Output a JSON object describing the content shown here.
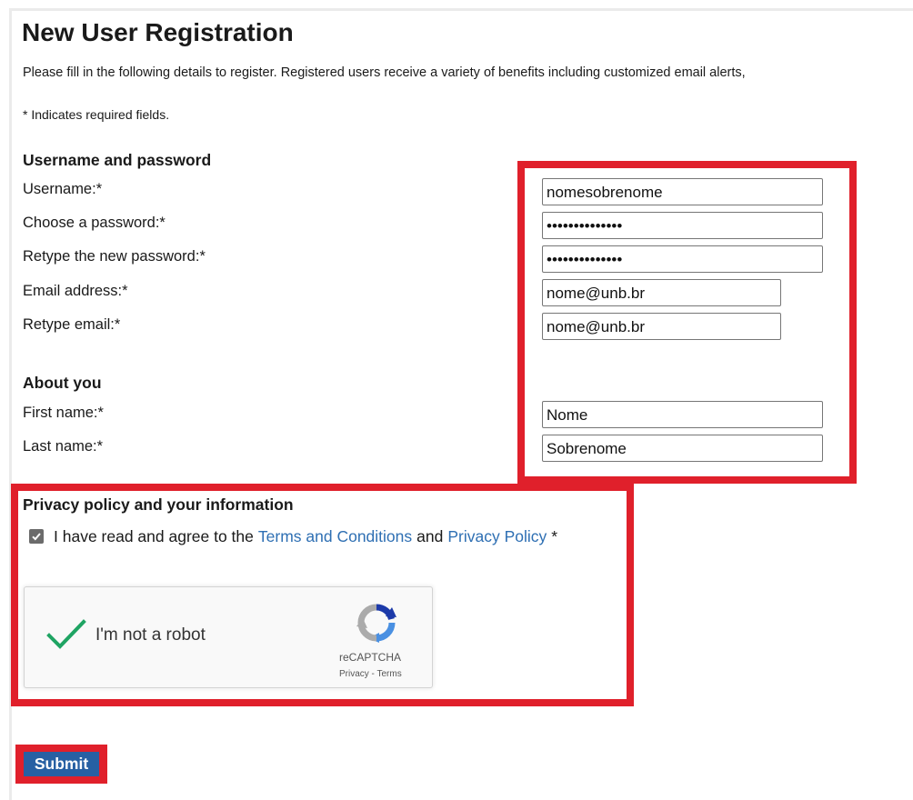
{
  "page": {
    "title": "New User Registration",
    "intro": "Please fill in the following details to register. Registered users receive a variety of benefits including customized email alerts,",
    "required_note": "* Indicates required fields."
  },
  "credentials": {
    "section_title": "Username and password",
    "username_label": "Username:*",
    "username_value": "nomesobrenome",
    "password_label": "Choose a password:*",
    "password_value": "nomesobrenome1",
    "retype_password_label": "Retype the new password:*",
    "retype_password_value": "nomesobrenome1",
    "email_label": "Email address:*",
    "email_value": "nome@unb.br",
    "retype_email_label": "Retype email:*",
    "retype_email_value": "nome@unb.br"
  },
  "about": {
    "section_title": "About you",
    "first_name_label": "First name:*",
    "first_name_value": "Nome",
    "last_name_label": "Last name:*",
    "last_name_value": "Sobrenome"
  },
  "privacy": {
    "section_title": "Privacy policy and your information",
    "agree_prefix": "I have read and agree to the",
    "terms_link": "Terms and Conditions",
    "and_text": "and",
    "privacy_link": "Privacy Policy",
    "required_mark": "*",
    "checked": true
  },
  "recaptcha": {
    "label": "I'm not a robot",
    "brand": "reCAPTCHA",
    "legal": "Privacy - Terms",
    "verified": true,
    "check_icon": "checkmark-icon",
    "logo_icon": "recaptcha-logo-icon"
  },
  "actions": {
    "submit_label": "Submit"
  },
  "colors": {
    "highlight": "#e0202b",
    "link": "#2e6fb3",
    "submit_bg": "#2760a3",
    "check_green": "#1fa463"
  }
}
